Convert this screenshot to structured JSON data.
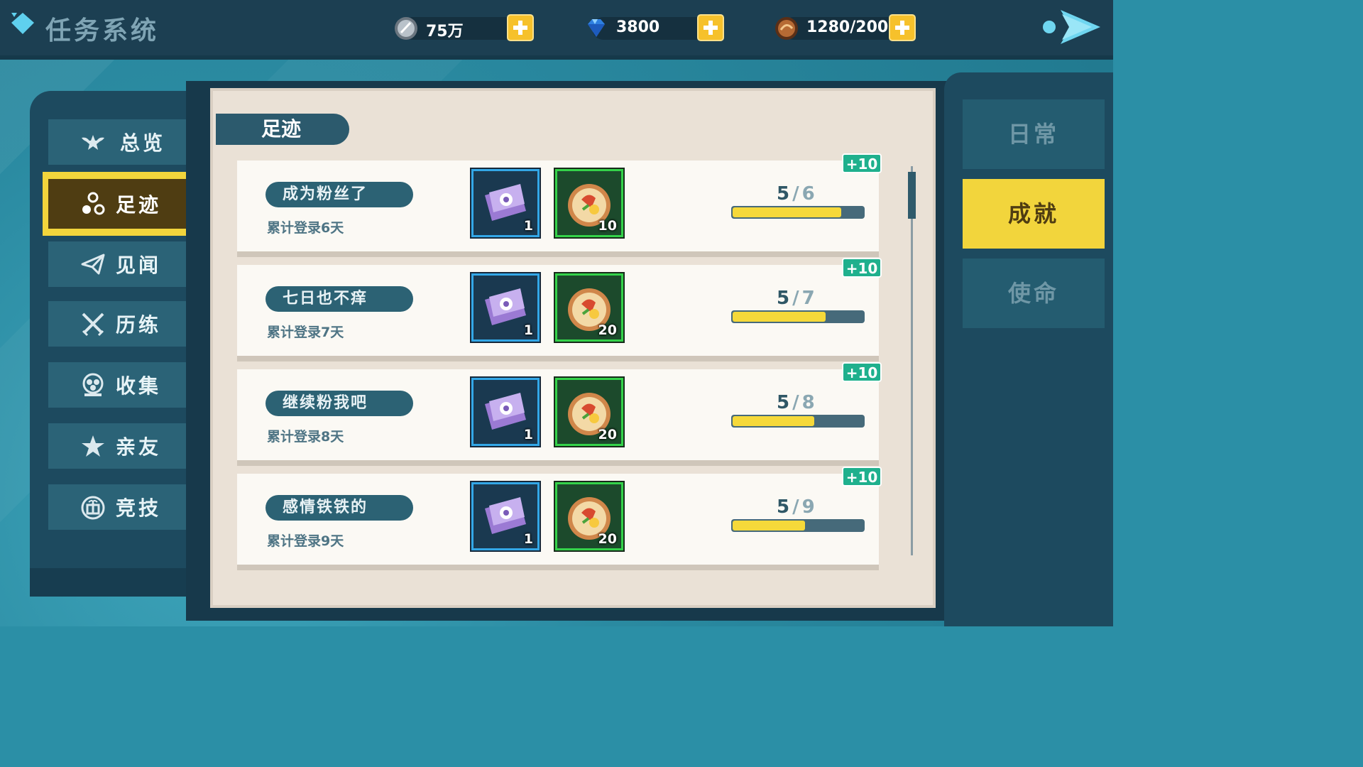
{
  "header": {
    "title": "任务系统",
    "resources": [
      {
        "icon": "silver-coin-icon",
        "value": "75万"
      },
      {
        "icon": "diamond-gem-icon",
        "value": "3800"
      },
      {
        "icon": "bread-stamina-icon",
        "value": "1280/200"
      }
    ]
  },
  "left_nav": [
    {
      "icon": "wings-star-icon",
      "label": "总览",
      "active": false
    },
    {
      "icon": "footprint-icon",
      "label": "足迹",
      "active": true
    },
    {
      "icon": "paper-plane-icon",
      "label": "见闻",
      "active": false
    },
    {
      "icon": "crossed-swords-icon",
      "label": "历练",
      "active": false
    },
    {
      "icon": "collection-icon",
      "label": "收集",
      "active": false
    },
    {
      "icon": "star-icon",
      "label": "亲友",
      "active": false
    },
    {
      "icon": "gift-icon",
      "label": "竞技",
      "active": false
    }
  ],
  "panel": {
    "tab_label": "足迹",
    "tasks": [
      {
        "name": "成为粉丝了",
        "desc": "累计登录6天",
        "bonus": "+10",
        "rewards": [
          {
            "icon": "purple-ticket-icon",
            "count": "1"
          },
          {
            "icon": "pizza-icon",
            "count": "10"
          }
        ],
        "progress": "5",
        "total": "6",
        "fraction": 0.8333
      },
      {
        "name": "七日也不痒",
        "desc": "累计登录7天",
        "bonus": "+10",
        "rewards": [
          {
            "icon": "purple-ticket-icon",
            "count": "1"
          },
          {
            "icon": "pizza-icon",
            "count": "20"
          }
        ],
        "progress": "5",
        "total": "7",
        "fraction": 0.7143
      },
      {
        "name": "继续粉我吧",
        "desc": "累计登录8天",
        "bonus": "+10",
        "rewards": [
          {
            "icon": "purple-ticket-icon",
            "count": "1"
          },
          {
            "icon": "pizza-icon",
            "count": "20"
          }
        ],
        "progress": "5",
        "total": "8",
        "fraction": 0.625
      },
      {
        "name": "感情铁铁的",
        "desc": "累计登录9天",
        "bonus": "+10",
        "rewards": [
          {
            "icon": "purple-ticket-icon",
            "count": "1"
          },
          {
            "icon": "pizza-icon",
            "count": "20"
          }
        ],
        "progress": "5",
        "total": "9",
        "fraction": 0.5556
      }
    ]
  },
  "right_nav": [
    {
      "label": "日常",
      "active": false
    },
    {
      "label": "成就",
      "active": true
    },
    {
      "label": "使命",
      "active": false
    }
  ],
  "colors": {
    "accent_yellow": "#f2d53c",
    "bonus_green": "#1fb08d",
    "nav_dark": "#1d4a5f"
  }
}
